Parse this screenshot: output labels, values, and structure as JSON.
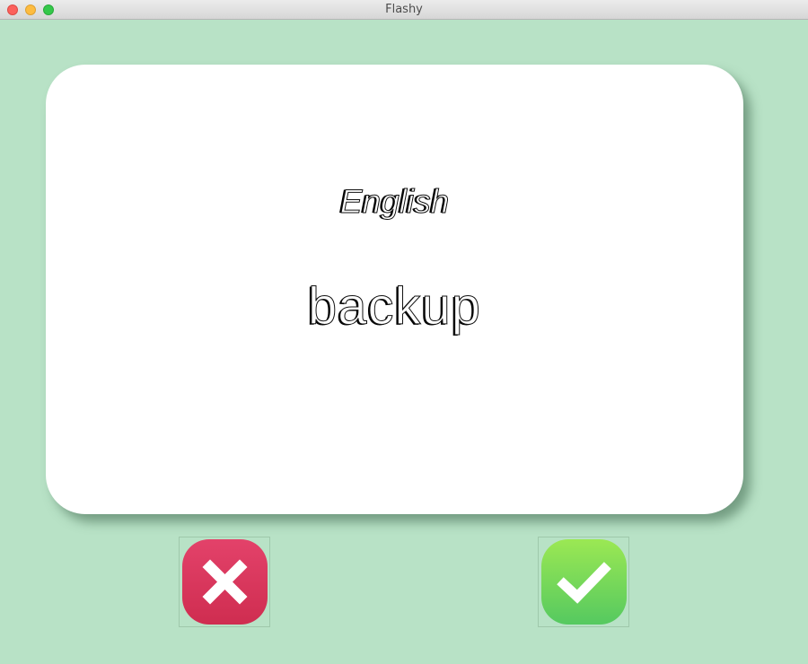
{
  "window": {
    "title": "Flashy"
  },
  "card": {
    "language": "English",
    "word": "backup"
  },
  "buttons": {
    "wrong_icon": "x-mark-icon",
    "right_icon": "checkmark-icon"
  },
  "colors": {
    "background": "#b8e2c6",
    "card": "#ffffff",
    "wrong": "#d8345a",
    "right": "#7ad85a"
  }
}
